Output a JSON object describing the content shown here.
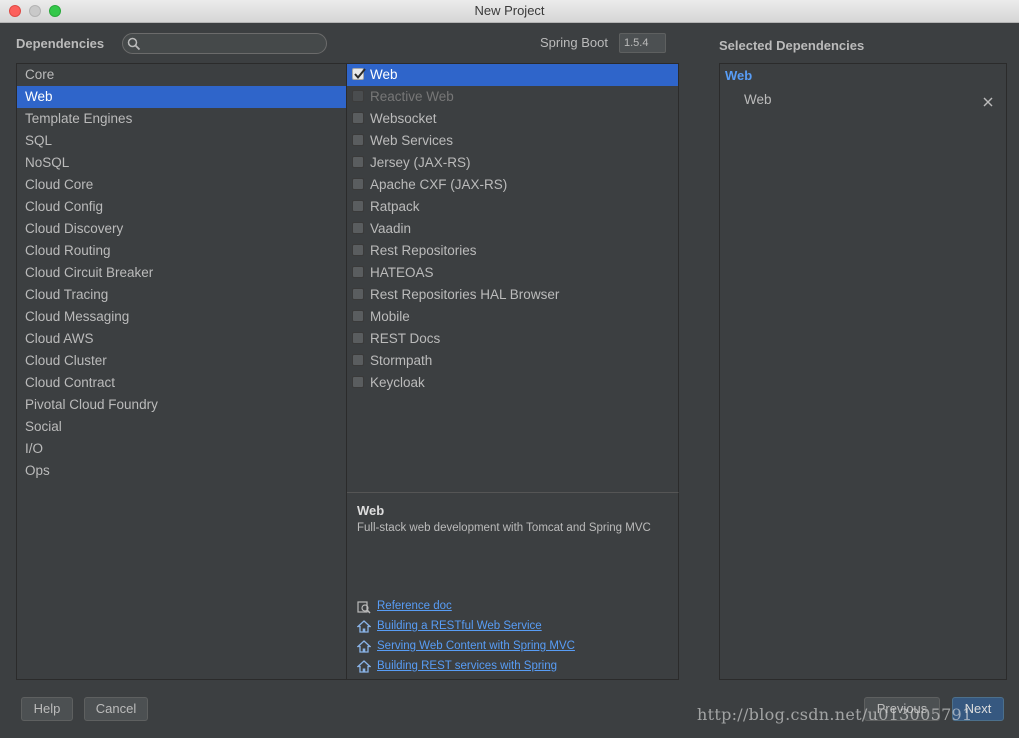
{
  "window": {
    "title": "New Project"
  },
  "header": {
    "dependencies_label": "Dependencies",
    "search": {
      "placeholder": "",
      "value": ""
    },
    "spring_boot_label": "Spring Boot",
    "spring_boot_version": "1.5.4",
    "selected_dependencies_label": "Selected Dependencies"
  },
  "categories": [
    {
      "label": "Core",
      "selected": false
    },
    {
      "label": "Web",
      "selected": true
    },
    {
      "label": "Template Engines",
      "selected": false
    },
    {
      "label": "SQL",
      "selected": false
    },
    {
      "label": "NoSQL",
      "selected": false
    },
    {
      "label": "Cloud Core",
      "selected": false
    },
    {
      "label": "Cloud Config",
      "selected": false
    },
    {
      "label": "Cloud Discovery",
      "selected": false
    },
    {
      "label": "Cloud Routing",
      "selected": false
    },
    {
      "label": "Cloud Circuit Breaker",
      "selected": false
    },
    {
      "label": "Cloud Tracing",
      "selected": false
    },
    {
      "label": "Cloud Messaging",
      "selected": false
    },
    {
      "label": "Cloud AWS",
      "selected": false
    },
    {
      "label": "Cloud Cluster",
      "selected": false
    },
    {
      "label": "Cloud Contract",
      "selected": false
    },
    {
      "label": "Pivotal Cloud Foundry",
      "selected": false
    },
    {
      "label": "Social",
      "selected": false
    },
    {
      "label": "I/O",
      "selected": false
    },
    {
      "label": "Ops",
      "selected": false
    }
  ],
  "dependencies": [
    {
      "label": "Web",
      "checked": true,
      "selected": true,
      "disabled": false
    },
    {
      "label": "Reactive Web",
      "checked": false,
      "selected": false,
      "disabled": true
    },
    {
      "label": "Websocket",
      "checked": false,
      "selected": false,
      "disabled": false
    },
    {
      "label": "Web Services",
      "checked": false,
      "selected": false,
      "disabled": false
    },
    {
      "label": "Jersey (JAX-RS)",
      "checked": false,
      "selected": false,
      "disabled": false
    },
    {
      "label": "Apache CXF (JAX-RS)",
      "checked": false,
      "selected": false,
      "disabled": false
    },
    {
      "label": "Ratpack",
      "checked": false,
      "selected": false,
      "disabled": false
    },
    {
      "label": "Vaadin",
      "checked": false,
      "selected": false,
      "disabled": false
    },
    {
      "label": "Rest Repositories",
      "checked": false,
      "selected": false,
      "disabled": false
    },
    {
      "label": "HATEOAS",
      "checked": false,
      "selected": false,
      "disabled": false
    },
    {
      "label": "Rest Repositories HAL Browser",
      "checked": false,
      "selected": false,
      "disabled": false
    },
    {
      "label": "Mobile",
      "checked": false,
      "selected": false,
      "disabled": false
    },
    {
      "label": "REST Docs",
      "checked": false,
      "selected": false,
      "disabled": false
    },
    {
      "label": "Stormpath",
      "checked": false,
      "selected": false,
      "disabled": false
    },
    {
      "label": "Keycloak",
      "checked": false,
      "selected": false,
      "disabled": false
    }
  ],
  "description": {
    "title": "Web",
    "text": "Full-stack web development with Tomcat and Spring MVC",
    "links": [
      {
        "label": "Reference doc",
        "icon": "reference-doc-icon"
      },
      {
        "label": "Building a RESTful Web Service",
        "icon": "guide-home-icon"
      },
      {
        "label": "Serving Web Content with Spring MVC",
        "icon": "guide-home-icon"
      },
      {
        "label": "Building REST services with Spring",
        "icon": "guide-home-icon"
      }
    ]
  },
  "selected": {
    "group": "Web",
    "items": [
      {
        "label": "Web",
        "remove_icon": "close-icon"
      }
    ]
  },
  "footer": {
    "help": "Help",
    "cancel": "Cancel",
    "previous": "Previous",
    "next": "Next"
  },
  "watermark": "http://blog.csdn.net/u013005791",
  "colors": {
    "background": "#3c3f41",
    "selection": "#2f65ca",
    "link": "#589df6",
    "next_button": "#365880"
  }
}
